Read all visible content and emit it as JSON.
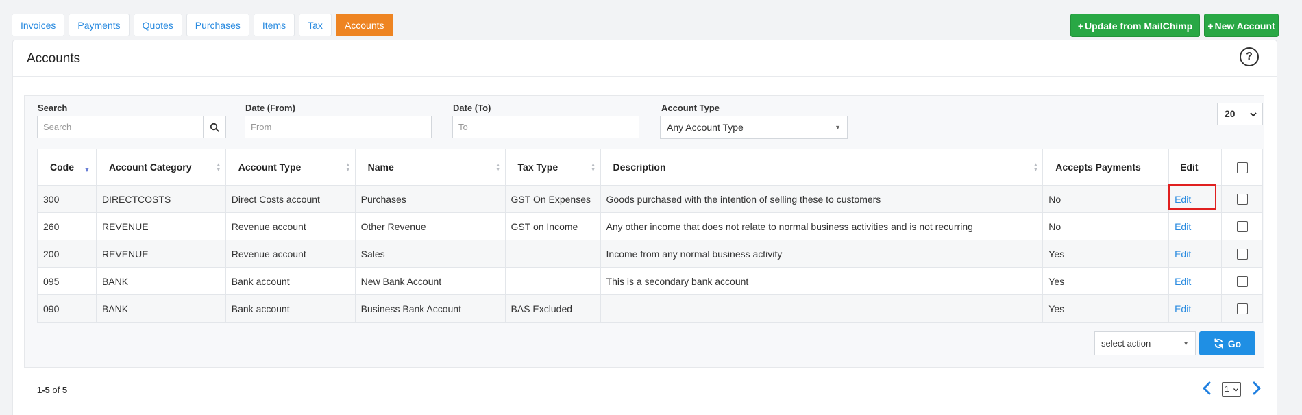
{
  "tabs": [
    {
      "label": "Invoices",
      "active": false
    },
    {
      "label": "Payments",
      "active": false
    },
    {
      "label": "Quotes",
      "active": false
    },
    {
      "label": "Purchases",
      "active": false
    },
    {
      "label": "Items",
      "active": false
    },
    {
      "label": "Tax",
      "active": false
    },
    {
      "label": "Accounts",
      "active": true
    }
  ],
  "buttons": {
    "update_mailchimp": "Update from MailChimp",
    "new_account": "New Account",
    "go": "Go",
    "plus": "+"
  },
  "panel": {
    "title": "Accounts",
    "help": "?"
  },
  "filters": {
    "search_label": "Search",
    "search_placeholder": "Search",
    "date_from_label": "Date (From)",
    "date_from_placeholder": "From",
    "date_to_label": "Date (To)",
    "date_to_placeholder": "To",
    "account_type_label": "Account Type",
    "account_type_value": "Any Account Type",
    "page_size": "20"
  },
  "table": {
    "headers": [
      "Code",
      "Account Category",
      "Account Type",
      "Name",
      "Tax Type",
      "Description",
      "Accepts Payments",
      "Edit"
    ],
    "rows": [
      {
        "code": "300",
        "category": "DIRECTCOSTS",
        "type": "Direct Costs account",
        "name": "Purchases",
        "tax": "GST On Expenses",
        "description": "Goods purchased with the intention of selling these to customers",
        "accepts": "No",
        "edit": "Edit"
      },
      {
        "code": "260",
        "category": "REVENUE",
        "type": "Revenue account",
        "name": "Other Revenue",
        "tax": "GST on Income",
        "description": "Any other income that does not relate to normal business activities and is not recurring",
        "accepts": "No",
        "edit": "Edit"
      },
      {
        "code": "200",
        "category": "REVENUE",
        "type": "Revenue account",
        "name": "Sales",
        "tax": "",
        "description": "Income from any normal business activity",
        "accepts": "Yes",
        "edit": "Edit"
      },
      {
        "code": "095",
        "category": "BANK",
        "type": "Bank account",
        "name": "New Bank Account",
        "tax": "",
        "description": "This is a secondary bank account",
        "accepts": "Yes",
        "edit": "Edit"
      },
      {
        "code": "090",
        "category": "BANK",
        "type": "Bank account",
        "name": "Business Bank Account",
        "tax": "BAS Excluded",
        "description": "",
        "accepts": "Yes",
        "edit": "Edit"
      }
    ]
  },
  "bulk": {
    "select_action": "select action"
  },
  "pager": {
    "range": "1-5",
    "of": "of",
    "total": "5",
    "page": "1"
  },
  "colors": {
    "accent": "#ee8422",
    "primary": "#1f8fe4",
    "success": "#29a845",
    "highlight": "#e02020"
  },
  "icons": [
    "search-icon",
    "help-icon",
    "refresh-icon",
    "chevron-left-icon",
    "chevron-right-icon",
    "caret-down-icon"
  ]
}
